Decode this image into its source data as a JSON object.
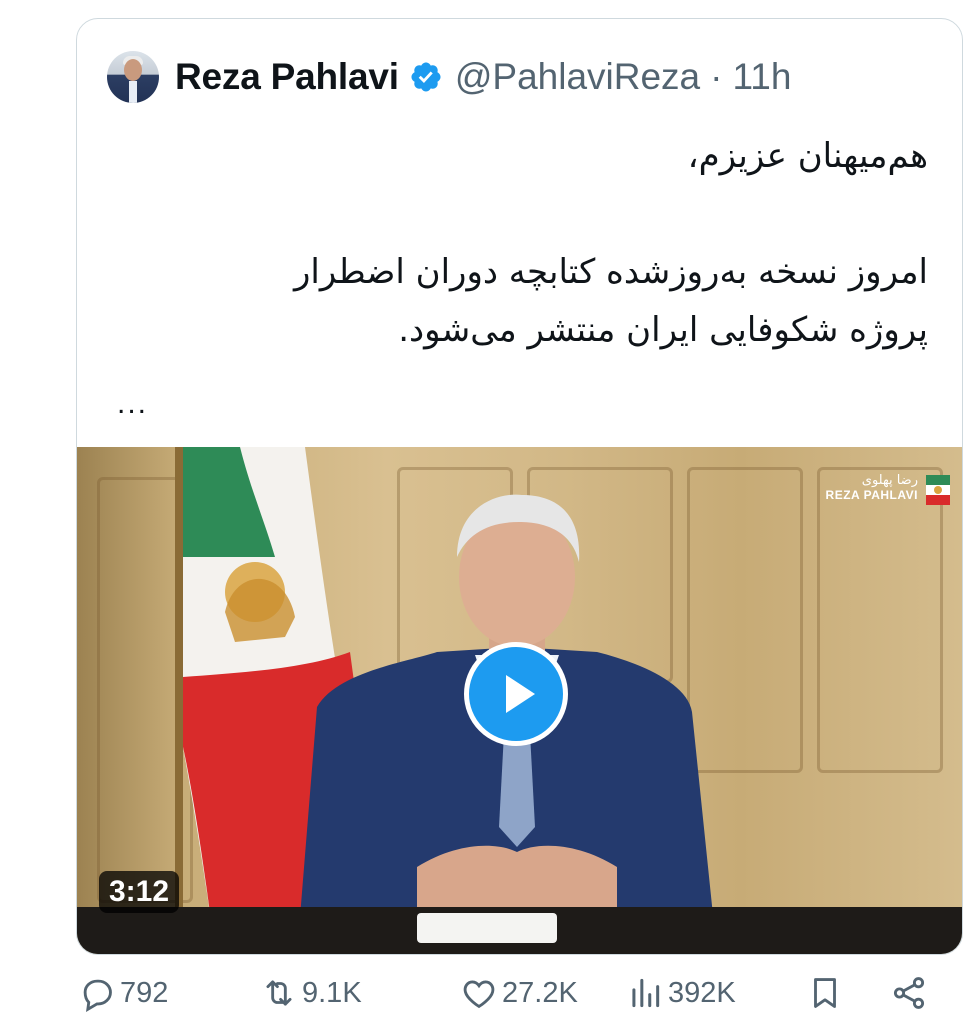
{
  "tweet": {
    "author_name": "Reza Pahlavi",
    "handle": "@PahlaviReza",
    "separator": "·",
    "time": "11h",
    "text_lines": [
      "هم‌میهنان عزیزم،",
      "امروز نسخه به‌روزشده کتابچه دوران اضطرار",
      "پروژه شکوفایی ایران منتشر می‌شود."
    ],
    "more": "...",
    "video": {
      "duration": "3:12",
      "watermark_fa": "رضا پهلوی",
      "watermark_en": "REZA PAHLAVI"
    },
    "stats": {
      "replies": "792",
      "reposts": "9.1K",
      "likes": "27.2K",
      "views": "392K"
    }
  },
  "colors": {
    "accent": "#1d9bf0",
    "muted": "#536471",
    "border": "#cfd9de",
    "text": "#0f1419"
  }
}
